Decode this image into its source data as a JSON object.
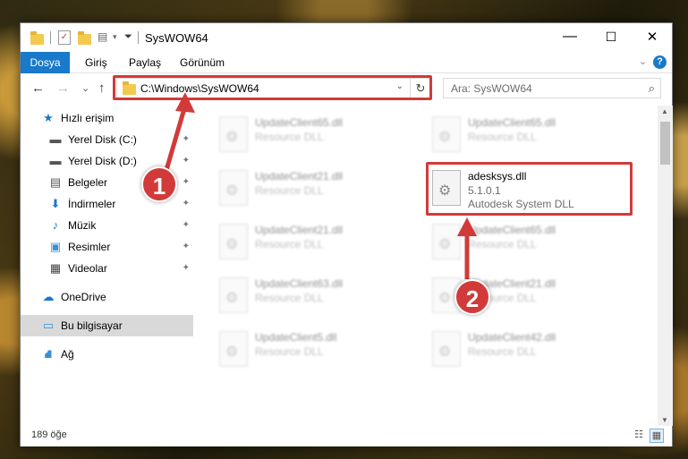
{
  "window": {
    "title": "SysWOW64",
    "minimize": "—",
    "maximize": "☐",
    "close": "✕"
  },
  "ribbon": {
    "tabs": [
      "Dosya",
      "Giriş",
      "Paylaş",
      "Görünüm"
    ],
    "help": "?",
    "collapse": "⌄"
  },
  "nav": {
    "back": "←",
    "forward": "→",
    "recent": "⌄",
    "up": "↑",
    "address": "C:\\Windows\\SysWOW64",
    "address_dropdown": "⌄",
    "refresh": "↻",
    "search_placeholder": "Ara: SysWOW64"
  },
  "sidebar": {
    "items": [
      {
        "label": "Hızlı erişim",
        "icon": "star-icon",
        "glyph": "★",
        "color": "#1979ca"
      },
      {
        "label": "Yerel Disk (C:)",
        "icon": "drive-icon",
        "glyph": "▬",
        "color": "#555555",
        "pinned": true
      },
      {
        "label": "Yerel Disk (D:)",
        "icon": "drive-icon",
        "glyph": "▬",
        "color": "#555555",
        "pinned": true
      },
      {
        "label": "Belgeler",
        "icon": "documents-icon",
        "glyph": "▤",
        "color": "#555555",
        "pinned": true
      },
      {
        "label": "İndirmeler",
        "icon": "download-icon",
        "glyph": "⬇",
        "color": "#1979ca",
        "pinned": true
      },
      {
        "label": "Müzik",
        "icon": "music-icon",
        "glyph": "♪",
        "color": "#1979ca",
        "pinned": true
      },
      {
        "label": "Resimler",
        "icon": "pictures-icon",
        "glyph": "▣",
        "color": "#3b8fd6",
        "pinned": true
      },
      {
        "label": "Videolar",
        "icon": "video-icon",
        "glyph": "▦",
        "color": "#444444",
        "pinned": true
      },
      {
        "label": "OneDrive",
        "icon": "cloud-icon",
        "glyph": "☁",
        "color": "#1979ca"
      },
      {
        "label": "Bu bilgisayar",
        "icon": "computer-icon",
        "glyph": "▭",
        "color": "#3b8fd6",
        "selected": true
      },
      {
        "label": "Ağ",
        "icon": "network-icon",
        "glyph": "⛘",
        "color": "#3b8fd6"
      }
    ],
    "pin_glyph": "📌"
  },
  "files": [
    {
      "name": "UpdateClient65.dll",
      "sub": "Resource DLL",
      "blurred": true
    },
    {
      "name": "UpdateClient65.dll",
      "sub": "Resource DLL",
      "blurred": true
    },
    {
      "name": "UpdateClient21.dll",
      "sub": "Resource DLL",
      "blurred": true
    },
    {
      "name": "adesksys.dll",
      "version": "5.1.0.1",
      "desc": "Autodesk System DLL",
      "blurred": false
    },
    {
      "name": "UpdateClient21.dll",
      "sub": "Resource DLL",
      "blurred": true
    },
    {
      "name": "UpdateClient65.dll",
      "sub": "Resource DLL",
      "blurred": true
    },
    {
      "name": "UpdateClient63.dll",
      "sub": "Resource DLL",
      "blurred": true
    },
    {
      "name": "UpdateClient21.dll",
      "sub": "Resource DLL",
      "blurred": true
    },
    {
      "name": "UpdateClient5.dll",
      "sub": "Resource DLL",
      "blurred": true
    },
    {
      "name": "UpdateClient42.dll",
      "sub": "Resource DLL",
      "blurred": true
    }
  ],
  "status": {
    "count": "189 öğe"
  },
  "callouts": {
    "step1": "1",
    "step2": "2",
    "color": "#d23a3a"
  }
}
